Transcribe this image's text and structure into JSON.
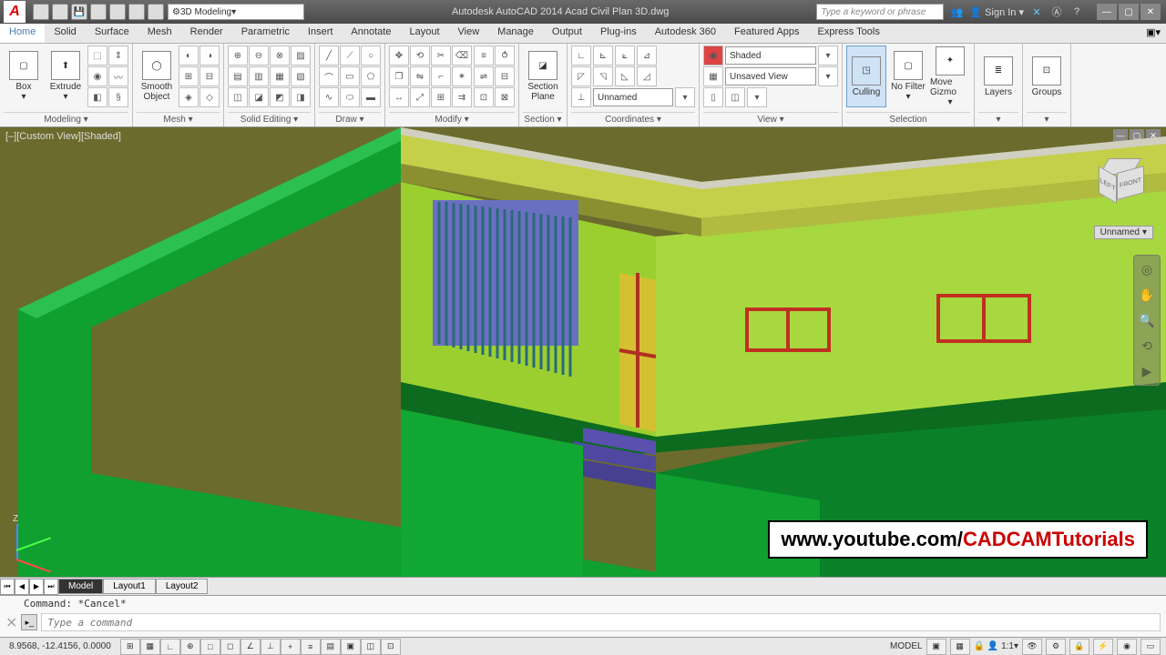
{
  "app": {
    "title": "Autodesk AutoCAD 2014   Acad Civil Plan 3D.dwg",
    "workspace": "3D Modeling",
    "search_placeholder": "Type a keyword or phrase",
    "sign_in": "Sign In"
  },
  "ribbon_tabs": [
    "Home",
    "Solid",
    "Surface",
    "Mesh",
    "Render",
    "Parametric",
    "Insert",
    "Annotate",
    "Layout",
    "View",
    "Manage",
    "Output",
    "Plug-ins",
    "Autodesk 360",
    "Featured Apps",
    "Express Tools"
  ],
  "ribbon": {
    "modeling": {
      "title": "Modeling ▾",
      "box": "Box",
      "extrude": "Extrude"
    },
    "mesh": {
      "title": "Mesh ▾",
      "smooth": "Smooth\nObject"
    },
    "solid_editing": {
      "title": "Solid Editing ▾"
    },
    "draw": {
      "title": "Draw ▾"
    },
    "modify": {
      "title": "Modify ▾"
    },
    "section": {
      "title": "Section ▾",
      "plane": "Section\nPlane"
    },
    "coordinates": {
      "title": "Coordinates ▾",
      "unnamed": "Unnamed"
    },
    "view": {
      "title": "View ▾",
      "shaded": "Shaded",
      "unsaved": "Unsaved View"
    },
    "selection": {
      "title": "Selection",
      "culling": "Culling",
      "nofilter": "No Filter",
      "gizmo": "Move Gizmo"
    },
    "layers": {
      "title": "▾",
      "label": "Layers"
    },
    "groups": {
      "title": "▾",
      "label": "Groups"
    }
  },
  "viewport": {
    "label": "[–][Custom View][Shaded]",
    "unnamed_dd": "Unnamed",
    "cube": {
      "top": "",
      "left": "LEFT",
      "front": "FRONT"
    }
  },
  "layout_tabs": {
    "model": "Model",
    "l1": "Layout1",
    "l2": "Layout2"
  },
  "command": {
    "history": "Command: *Cancel*",
    "placeholder": "Type a command"
  },
  "status": {
    "coords": "8.9568, -12.4156, 0.0000",
    "model": "MODEL",
    "scale": "1:1"
  },
  "watermark": {
    "prefix": "www.youtube.com/",
    "channel": "CADCAMTutorials"
  }
}
